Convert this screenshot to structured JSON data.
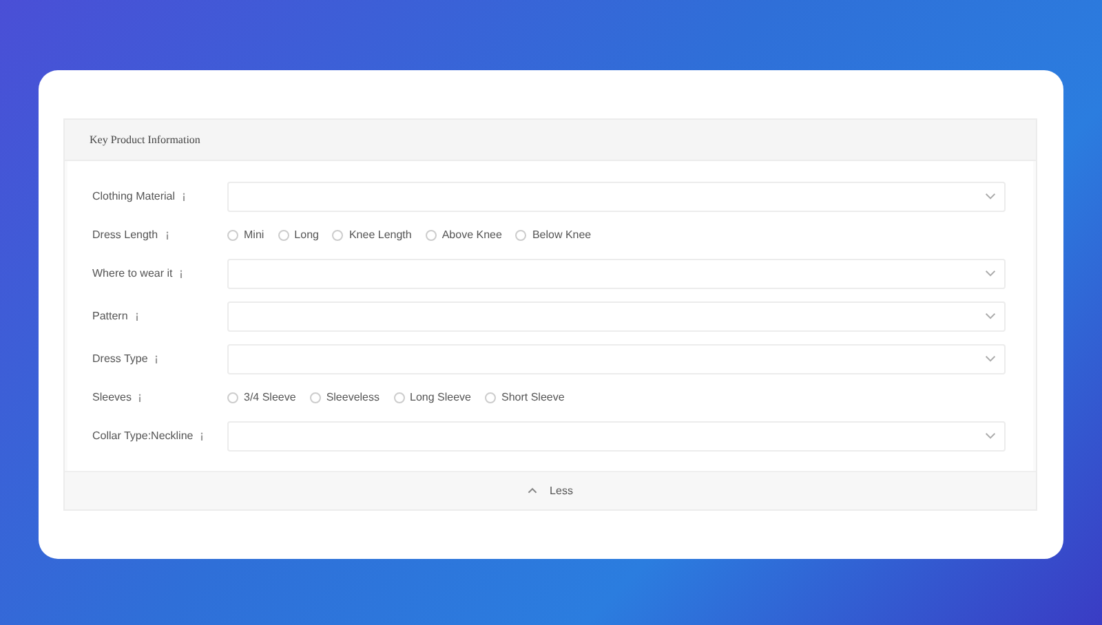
{
  "panel": {
    "title": "Key Product Information"
  },
  "fields": [
    {
      "kind": "select",
      "label": "Clothing Material"
    },
    {
      "kind": "radio",
      "label": "Dress Length",
      "options": [
        {
          "label": "Mini",
          "selected": false
        },
        {
          "label": "Long",
          "selected": false
        },
        {
          "label": "Knee Length",
          "selected": false
        },
        {
          "label": "Above Knee",
          "selected": false
        },
        {
          "label": "Below Knee",
          "selected": false
        }
      ]
    },
    {
      "kind": "select",
      "label": "Where to wear it"
    },
    {
      "kind": "select",
      "label": "Pattern"
    },
    {
      "kind": "select",
      "label": "Dress Type"
    },
    {
      "kind": "radio",
      "label": "Sleeves",
      "options": [
        {
          "label": "3/4 Sleeve",
          "selected": false
        },
        {
          "label": "Sleeveless",
          "selected": false
        },
        {
          "label": "Long Sleeve",
          "selected": false
        },
        {
          "label": "Short Sleeve",
          "selected": false
        }
      ]
    },
    {
      "kind": "select",
      "label": "Collar Type:Neckline"
    }
  ],
  "toggle": {
    "label": "Less"
  }
}
